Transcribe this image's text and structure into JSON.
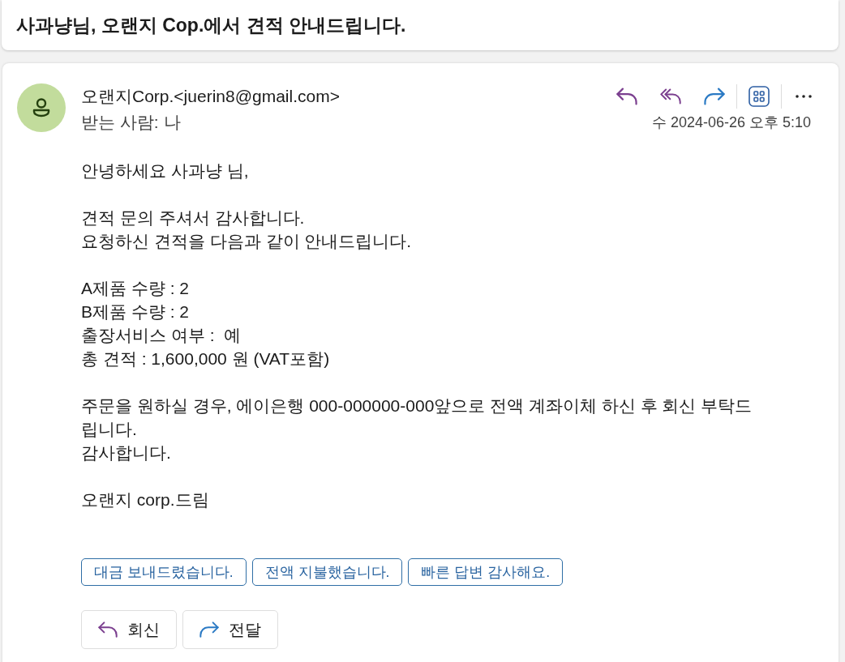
{
  "subject": "사과냥님, 오랜지 Cop.에서 견적 안내드립니다.",
  "message": {
    "sender": "오랜지Corp.<juerin8@gmail.com>",
    "recipient": "받는 사람: 나",
    "date": "수 2024-06-26 오후 5:10",
    "body": [
      [
        "안녕하세요 사과냥 님,"
      ],
      [
        "견적 문의 주셔서 감사합니다.",
        "요청하신 견적을 다음과 같이 안내드립니다."
      ],
      [
        "A제품 수량 : 2",
        "B제품 수량 : 2",
        "출장서비스 여부 :  예",
        "총 견적 : 1,600,000 원 (VAT포함)"
      ],
      [
        "주문을 원하실 경우, 에이은행 000-000000-000앞으로 전액 계좌이체 하신 후 회신 부탁드립니다.",
        "감사합니다."
      ],
      [
        "오랜지 corp.드림"
      ]
    ],
    "suggested_replies": [
      "대금 보내드렸습니다.",
      "전액 지불했습니다.",
      "빠른 답변 감사해요."
    ],
    "actions": [
      {
        "kind": "reply",
        "label": "회신"
      },
      {
        "kind": "forward",
        "label": "전달"
      }
    ]
  }
}
